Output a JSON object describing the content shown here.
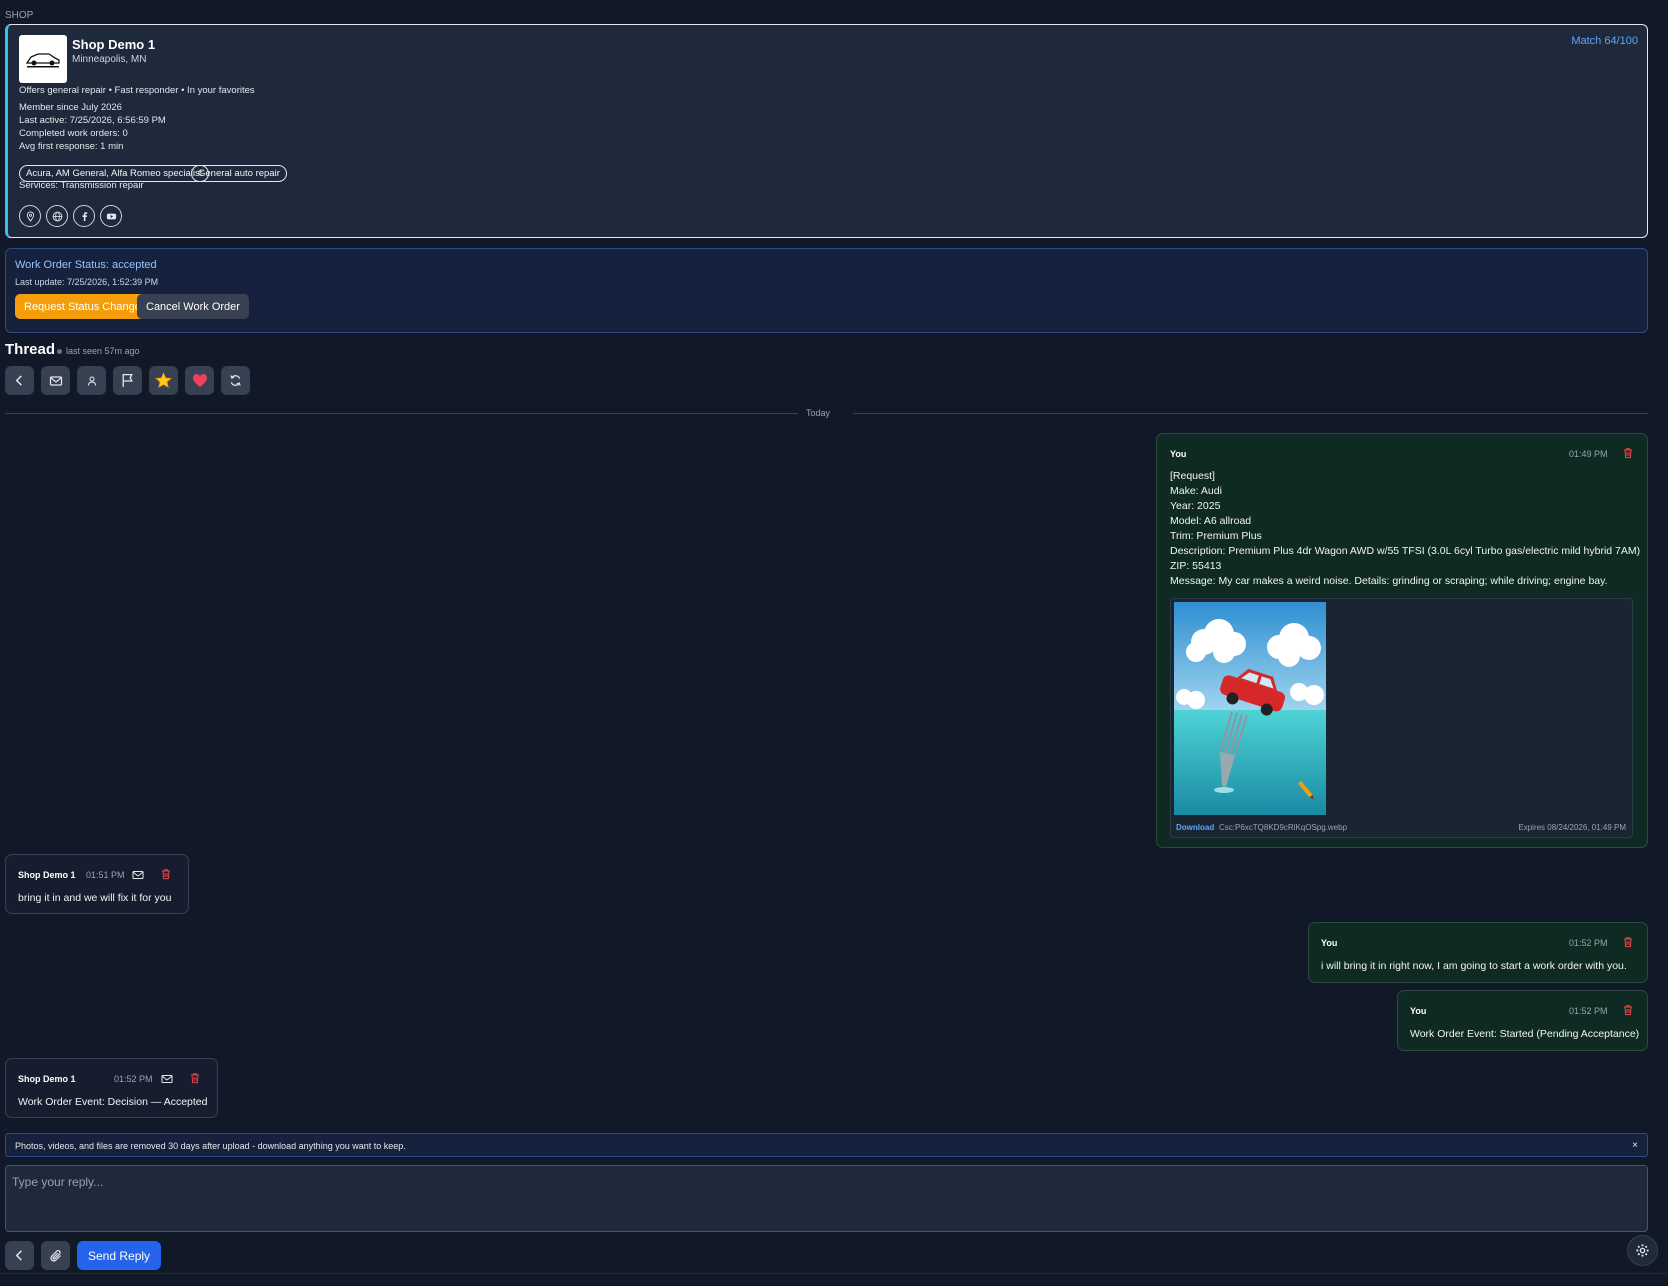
{
  "section_label": "SHOP",
  "shop": {
    "name": "Shop Demo 1",
    "location": "Minneapolis, MN",
    "match": "Match 64/100",
    "offers": "Offers general repair • Fast responder • In your favorites",
    "member_since": "Member since July 2026",
    "last_active": "Last active: 7/25/2026, 6:56:59 PM",
    "completed": "Completed work orders: 0",
    "avg_response": "Avg first response: 1 min",
    "tags": [
      "Acura, AM General, Alfa Romeo specialist",
      "General auto repair"
    ],
    "services": "Services: Transmission repair",
    "social_icons": [
      "map-pin-icon",
      "globe-icon",
      "facebook-icon",
      "youtube-icon"
    ]
  },
  "work_order": {
    "status": "Work Order Status: accepted",
    "last_update": "Last update: 7/25/2026, 1:52:39 PM",
    "request_change_label": "Request Status Change",
    "cancel_label": "Cancel Work Order"
  },
  "thread": {
    "title": "Thread",
    "last_seen": "last seen 57m ago",
    "toolbar_icons": [
      "back-icon",
      "mail-icon",
      "person-icon",
      "flag-icon",
      "star-icon",
      "heart-icon",
      "refresh-icon"
    ],
    "divider": "Today"
  },
  "messages": [
    {
      "sender": "You",
      "time": "01:49 PM",
      "body": "[Request]\nMake: Audi\nYear: 2025\nModel: A6 allroad\nTrim: Premium Plus\nDescription: Premium Plus 4dr Wagon AWD w/55 TFSI (3.0L 6cyl Turbo gas/electric mild hybrid 7AM)\nZIP: 55413\nMessage: My car makes a weird noise. Details: grinding or scraping; while driving; engine bay.",
      "attachment": {
        "download_label": "Download",
        "filename": "Csc:P6xcTQ8KD9cRlKqOSpg.webp",
        "expires": "Expires 08/24/2026, 01:49 PM"
      }
    },
    {
      "sender": "Shop Demo 1",
      "time": "01:51 PM",
      "body": "bring it in and we will fix it for you"
    },
    {
      "sender": "You",
      "time": "01:52 PM",
      "body": "i will bring it in right now, I am going to start a work order with you."
    },
    {
      "sender": "You",
      "time": "01:52 PM",
      "body": "Work Order Event: Started (Pending Acceptance)"
    },
    {
      "sender": "Shop Demo 1",
      "time": "01:52 PM",
      "body": "Work Order Event: Decision — Accepted"
    }
  ],
  "notice": {
    "text": "Photos, videos, and files are removed 30 days after upload - download anything you want to keep.",
    "close": "×"
  },
  "reply": {
    "placeholder": "Type your reply...",
    "send_label": "Send Reply"
  },
  "colors": {
    "background": "#111827",
    "accent_blue": "#60a5fa",
    "orange": "#f59e0b",
    "send_blue": "#2563eb",
    "danger": "#ef4444"
  }
}
